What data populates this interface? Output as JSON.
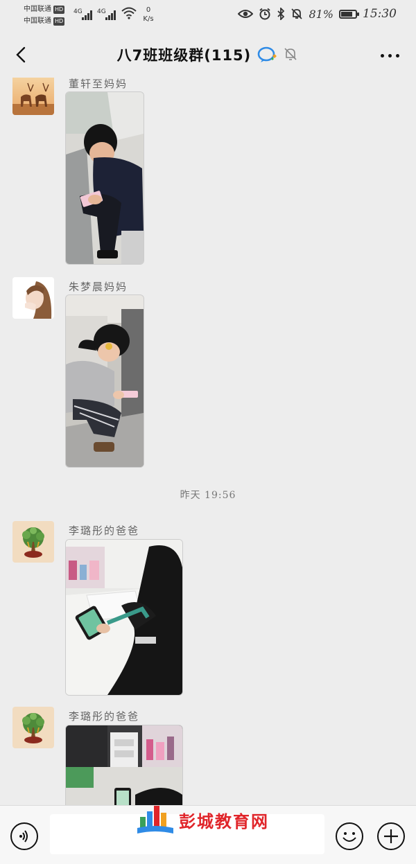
{
  "status_bar": {
    "carrier1": "中国联通",
    "carrier2": "中国联通",
    "hd_label": "HD",
    "network1": "4G",
    "network2": "4G",
    "speed_value": "0",
    "speed_unit": "K/s",
    "battery_percent": "81%",
    "battery_level": 0.81,
    "time": "15:30"
  },
  "header": {
    "title": "八7班班级群(115)"
  },
  "messages": [
    {
      "sender": "董轩至妈妈"
    },
    {
      "sender": "朱梦晨妈妈"
    },
    {
      "sender": "李璐彤的爸爸"
    },
    {
      "sender": "李璐彤的爸爸"
    }
  ],
  "time_separator": "昨天 19:56",
  "watermark": {
    "text": "彭城教育网"
  },
  "colors": {
    "background": "#ededed",
    "watermark_red": "#e0252a",
    "bubble_blue": "#2f8be6"
  },
  "icons": [
    "back-icon",
    "chat-bubble-icon",
    "mute-bell-icon",
    "more-icon",
    "eye-icon",
    "alarm-icon",
    "bluetooth-icon",
    "mute-icon",
    "wifi-icon",
    "voice-icon",
    "emoji-icon",
    "plus-icon"
  ]
}
